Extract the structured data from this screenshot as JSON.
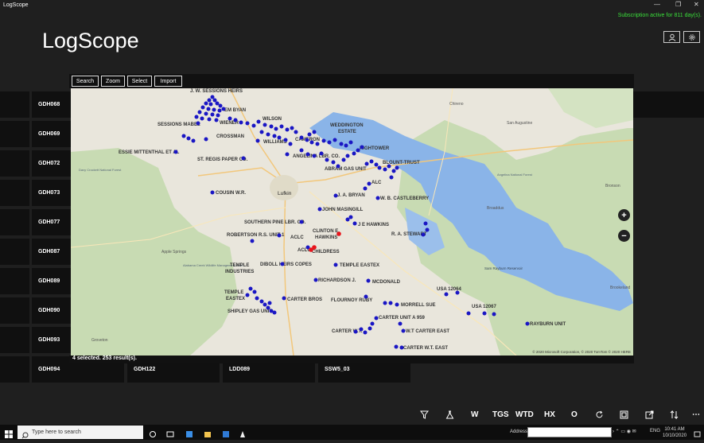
{
  "window": {
    "title": "LogScope"
  },
  "subscription": "Subscription active for 811 day(s).",
  "app": {
    "title": "LogScope"
  },
  "wells_left": [
    "GDH068",
    "GDH069",
    "GDH072",
    "GDH073",
    "GDH077",
    "GDH087",
    "GDH089",
    "GDH090",
    "GDH093"
  ],
  "wells_bottom": [
    "GDH094",
    "GDH122",
    "LDD089",
    "SSW5_03"
  ],
  "map_toolbar": {
    "search": "Search",
    "zoom": "Zoom",
    "select": "Select",
    "import": "Import"
  },
  "map": {
    "status": "4 selected. 253 result(s).",
    "copyright": "© 2020 Microsoft Corporation, © 2020 TomTom © 2020 HERE",
    "labels": [
      "J. W. SESSIONS HEIRS",
      "EM BYAN",
      "WILSON",
      "SESSIONS MABEL",
      "WIENER",
      "WEDDINGTON",
      "ESTATE",
      "CROSSMAN",
      "WILLIAMS",
      "CAMERON",
      "HIGHTOWER",
      "ESSIE MITTENTHAL ET AL",
      "ANGELINA LBR. CO.",
      "BLOUNT-TRUST",
      "ST. REGIS PAPER CO.",
      "ABRAM GAS UNIT",
      "ALC",
      "COUSIN W.R.",
      "J. A. BRYAN",
      "W. B. CASTLEBERRY",
      "JOHN MASINGILL",
      "SOUTHERN PINE LBR. CO.",
      "J E HAWKINS",
      "CLINTON E.",
      "HAWKINS",
      "R. A. STEWART",
      "ROBERTSON R.S. UNIT 1",
      "ACLC",
      "ACLC",
      "CHILDRESS",
      "DIBOLL HEIRS COPES",
      "TEMPLE",
      "INDUSTRIES",
      "TEMPLE EASTEX",
      "MCDONALD",
      "RICHARDSON J.",
      "USA 12064",
      "TEMPLE",
      "EASTEX",
      "CARTER BROS",
      "FLOURNOY RUBY",
      "MORRELL SUE",
      "USA 12067",
      "SHIPLEY GAS UNIT",
      "CARTER UNIT A 959",
      "RAYBURN UNIT",
      "CARTER W.T.",
      "W.T CARTER EAST",
      "CARTER W.T. EAST"
    ],
    "places": [
      "Lufkin",
      "Chireno",
      "Broaddus",
      "Apple Springs",
      "Alabama Creek Wildlife Management Area",
      "Davy Crockett National Forest",
      "Angelina National Forest",
      "San Augustine",
      "Bronson",
      "Brookeland",
      "Groveton",
      "Sam Rayburn Reservoir"
    ]
  },
  "bottom_tools": [
    "W",
    "TGS",
    "WTD",
    "HX",
    "O"
  ],
  "taskbar": {
    "search_placeholder": "Type here to search",
    "address_label": "Address",
    "lang": "ENG",
    "time": "10:41 AM",
    "date": "10/10/2020"
  }
}
